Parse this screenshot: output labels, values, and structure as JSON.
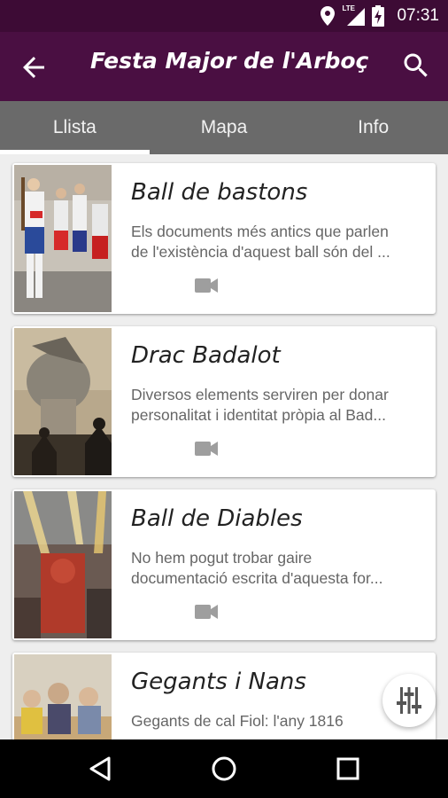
{
  "status": {
    "time": "07:31",
    "network": "LTE"
  },
  "appbar": {
    "title": "Festa Major de l'Arboç",
    "back_icon": "arrow-back-icon",
    "search_icon": "search-icon"
  },
  "tabs": [
    {
      "label": "Llista",
      "active": true
    },
    {
      "label": "Mapa",
      "active": false
    },
    {
      "label": "Info",
      "active": false
    }
  ],
  "items": [
    {
      "title": "Ball de bastons",
      "desc_line1": "Els documents més antics que parlen",
      "desc_line2": "de l'existència d'aquest ball són del ...",
      "icon": "video-camera-icon"
    },
    {
      "title": "Drac Badalot",
      "desc_line1": "Diversos elements serviren per donar",
      "desc_line2": "personalitat i identitat pròpia al Bad...",
      "icon": "video-camera-icon"
    },
    {
      "title": "Ball de Diables",
      "desc_line1": "No hem pogut trobar gaire",
      "desc_line2": "documentació escrita d'aquesta for...",
      "icon": "video-camera-icon"
    },
    {
      "title": "Gegants i Nans",
      "desc_line1": "Gegants de cal Fiol: l'any 1816",
      "desc_line2": "",
      "icon": "video-camera-icon"
    }
  ],
  "colors": {
    "appbar": "#4a0f42",
    "statusbar": "#3d0b35",
    "tabs": "#6a6a6a"
  },
  "fab": {
    "icon": "filter-sliders-icon"
  },
  "navbar": {
    "back": "nav-back-icon",
    "home": "nav-home-icon",
    "recents": "nav-recents-icon"
  }
}
